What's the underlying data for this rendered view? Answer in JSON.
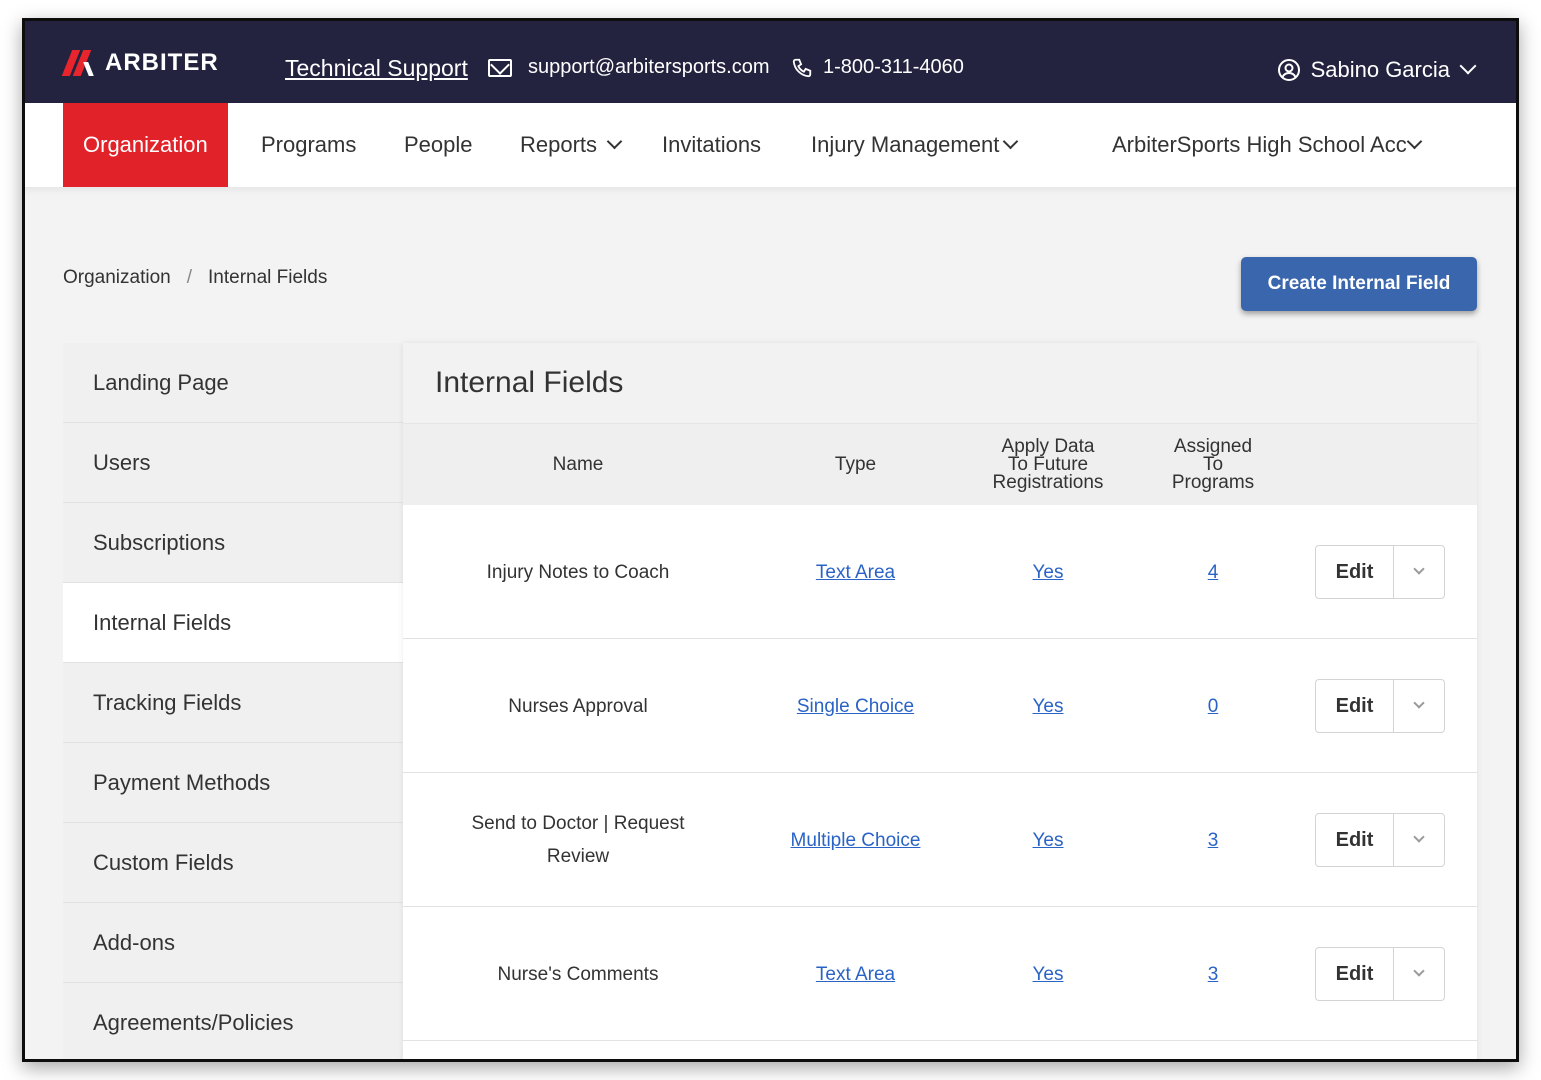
{
  "header": {
    "brand": "ARBITER",
    "support_link": "Technical Support",
    "email": "support@arbitersports.com",
    "phone": "1-800-311-4060",
    "user_name": "Sabino Garcia"
  },
  "nav": {
    "items": [
      {
        "label": "Organization",
        "active": true
      },
      {
        "label": "Programs"
      },
      {
        "label": "People"
      },
      {
        "label": "Reports"
      },
      {
        "label": "Invitations"
      },
      {
        "label": "Injury Management"
      },
      {
        "label": "ArbiterSports High School Acc"
      }
    ]
  },
  "breadcrumb": {
    "root": "Organization",
    "separator": "/",
    "current": "Internal Fields"
  },
  "create_button": "Create Internal Field",
  "sidebar": {
    "items": [
      {
        "label": "Landing Page"
      },
      {
        "label": "Users"
      },
      {
        "label": "Subscriptions"
      },
      {
        "label": "Internal Fields",
        "active": true
      },
      {
        "label": "Tracking Fields"
      },
      {
        "label": "Payment Methods"
      },
      {
        "label": "Custom Fields"
      },
      {
        "label": "Add-ons"
      },
      {
        "label": "Agreements/Policies"
      }
    ]
  },
  "panel": {
    "title": "Internal Fields",
    "columns": {
      "name": "Name",
      "type": "Type",
      "apply_line1": "Apply Data",
      "apply_line2": "To Future",
      "apply_line3": "Registrations",
      "assigned_line1": "Assigned",
      "assigned_line2": "To",
      "assigned_line3": "Programs"
    },
    "rows": [
      {
        "name_line1": "Injury Notes to Coach",
        "name_line2": "",
        "type": "Text Area",
        "apply": "Yes",
        "assigned": "4",
        "action": "Edit"
      },
      {
        "name_line1": "Nurses Approval",
        "name_line2": "",
        "type": "Single Choice",
        "apply": "Yes",
        "assigned": "0",
        "action": "Edit"
      },
      {
        "name_line1": "Send to Doctor | Request",
        "name_line2": "Review",
        "type": "Multiple Choice",
        "apply": "Yes",
        "assigned": "3",
        "action": "Edit"
      },
      {
        "name_line1": "Nurse's Comments",
        "name_line2": "",
        "type": "Text Area",
        "apply": "Yes",
        "assigned": "3",
        "action": "Edit"
      }
    ]
  },
  "colors": {
    "topbar": "#23233f",
    "accent_red": "#e12228",
    "primary_button": "#3a66ad",
    "link": "#2a63c6"
  },
  "icons": {
    "mail": "envelope-icon",
    "phone": "phone-icon",
    "user": "user-circle-icon",
    "dropdown": "chevron-down-icon"
  }
}
